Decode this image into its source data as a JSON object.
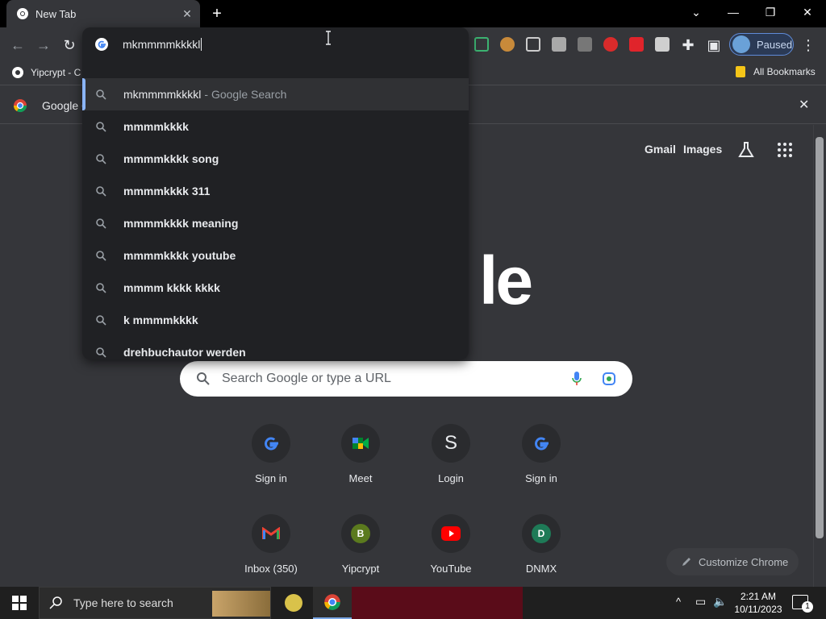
{
  "tab": {
    "title": "New Tab",
    "close": "✕",
    "new_tab": "+"
  },
  "window": {
    "minimize": "—",
    "restore": "❐",
    "close": "✕",
    "tabsearch": "⌄"
  },
  "profile": {
    "label": "Paused"
  },
  "bookmarks": {
    "first": "Yipcrypt - C",
    "all": "All Bookmarks"
  },
  "infobar": {
    "text": "Google C",
    "close": "✕"
  },
  "omnibox": {
    "value": "mkmmmmkkkkl",
    "suggestions": [
      {
        "text": "mkmmmmkkkkl",
        "suffix": "- Google Search"
      },
      {
        "text": "mmmmkkkk"
      },
      {
        "text": "mmmmkkkk song"
      },
      {
        "text": "mmmmkkkk 311"
      },
      {
        "text": "mmmmkkkk meaning"
      },
      {
        "text": "mmmmkkkk youtube"
      },
      {
        "text": "mmmm kkkk kkkk"
      },
      {
        "text": "k mmmmkkkk"
      },
      {
        "text": "drehbuchautor werden"
      }
    ]
  },
  "ntp": {
    "gmail": "Gmail",
    "images": "Images",
    "logo_partial": "le",
    "search_placeholder": "Search Google or type a URL",
    "shortcuts": [
      {
        "label": "Sign in",
        "letter": ""
      },
      {
        "label": "Meet",
        "letter": ""
      },
      {
        "label": "Login",
        "letter": "S"
      },
      {
        "label": "Sign in",
        "letter": ""
      },
      {
        "label": "Inbox (350)",
        "letter": ""
      },
      {
        "label": "Yipcrypt",
        "letter": "B"
      },
      {
        "label": "YouTube",
        "letter": ""
      },
      {
        "label": "DNMX",
        "letter": "D"
      }
    ],
    "customize": "Customize Chrome"
  },
  "taskbar": {
    "search_placeholder": "Type here to search",
    "time": "2:21 AM",
    "date": "10/11/2023",
    "notif_count": "1"
  },
  "colors": {
    "accent": "#8ab4f8",
    "toolbar": "#35363a",
    "dropdown": "#202124"
  }
}
